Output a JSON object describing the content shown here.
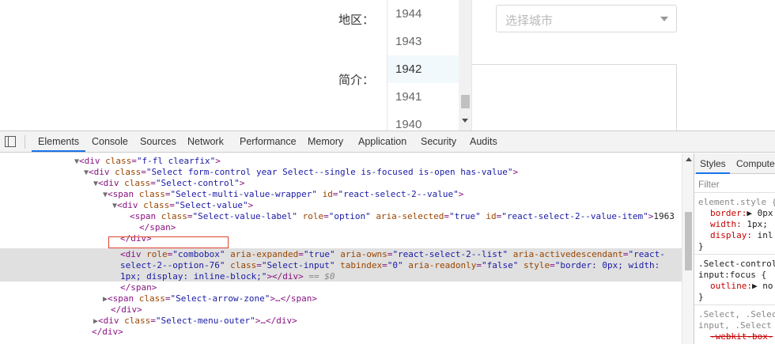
{
  "form": {
    "region_label": "地区：",
    "intro_label": "简介：",
    "city_placeholder": "选择城市"
  },
  "year_menu": {
    "options": [
      "1944",
      "1943",
      "1942",
      "1941",
      "1940"
    ],
    "focused": "1942"
  },
  "devtools": {
    "tabs": [
      "Elements",
      "Console",
      "Sources",
      "Network",
      "Performance",
      "Memory",
      "Application",
      "Security",
      "Audits"
    ],
    "active_tab": "Elements",
    "dom": {
      "l1_tag": "div",
      "l1_attr": "class",
      "l1_val": "\"f-fl clearfix\"",
      "l2_tag": "div",
      "l2_attr": "class",
      "l2_val": "\"Select form-control year Select--single is-focused is-open has-value\"",
      "l3_tag": "div",
      "l3_attr": "class",
      "l3_val": "\"Select-control\"",
      "l4_tag": "span",
      "l4_attr1": "class",
      "l4_val1": "\"Select-multi-value-wrapper\"",
      "l4_attr2": "id",
      "l4_val2": "\"react-select-2--value\"",
      "l5_tag": "div",
      "l5_attr": "class",
      "l5_val": "\"Select-value\"",
      "l6_tag": "span",
      "l6_attr1": "class",
      "l6_val1": "\"Select-value-label\"",
      "l6_attr2": "role",
      "l6_val2": "\"option\"",
      "l6_attr3": "aria-selected",
      "l6_val3": "\"true\"",
      "l6_attr4": "id",
      "l6_val4": "\"react-select-2--value-item\"",
      "l6_text": "1963",
      "l7_close": "</span>",
      "l8_close": "</div>",
      "sel_tag": "div",
      "sel_a1": "role",
      "sel_v1": "\"combobox\"",
      "sel_a2": "aria-expanded",
      "sel_v2": "\"true\"",
      "sel_a3": "aria-owns",
      "sel_v3": "\"react-select-2--list\"",
      "sel_a4": "aria-activedescendant",
      "sel_v4a": "\"react-",
      "sel_v4b": "select-2--option-76\"",
      "sel_a5": "class",
      "sel_v5": "\"Select-input\"",
      "sel_a6": "tabindex",
      "sel_v6": "\"0\"",
      "sel_a7": "aria-readonly",
      "sel_v7": "\"false\"",
      "sel_a8": "style",
      "sel_v8a": "\"border: 0px; width:",
      "sel_v8b": "1px; display: inline-block;\"",
      "sel_close": "></div>",
      "sel_eq": "== $0",
      "l12_close": "</span>",
      "l13_tag": "span",
      "l13_attr": "class",
      "l13_val": "\"Select-arrow-zone\"",
      "l13_rest": ">…</span>",
      "l14_close": "</div>",
      "l15_tag": "div",
      "l15_attr": "class",
      "l15_val": "\"Select-menu-outer\"",
      "l15_rest": ">…</div>",
      "l16_close": "</div>"
    },
    "styles": {
      "tabs": [
        "Styles",
        "Computed"
      ],
      "filter_placeholder": "Filter",
      "rule1_selector": "element.style {",
      "rule1_p1": "border:",
      "rule1_v1": "▶ 0px",
      "rule1_p2": "width:",
      "rule1_v2": "1px;",
      "rule1_p3": "display:",
      "rule1_v3": "inl",
      "rule1_close": "}",
      "rule2_sel1": ".Select-control",
      "rule2_sel2": "input:focus {",
      "rule2_p1": "outline:",
      "rule2_v1": "▶ no",
      "rule2_close": "}",
      "rule3_sel1": ".Select, .Select",
      "rule3_sel2": "input, .Select",
      "rule3_p1": "-webkit-box-"
    }
  }
}
